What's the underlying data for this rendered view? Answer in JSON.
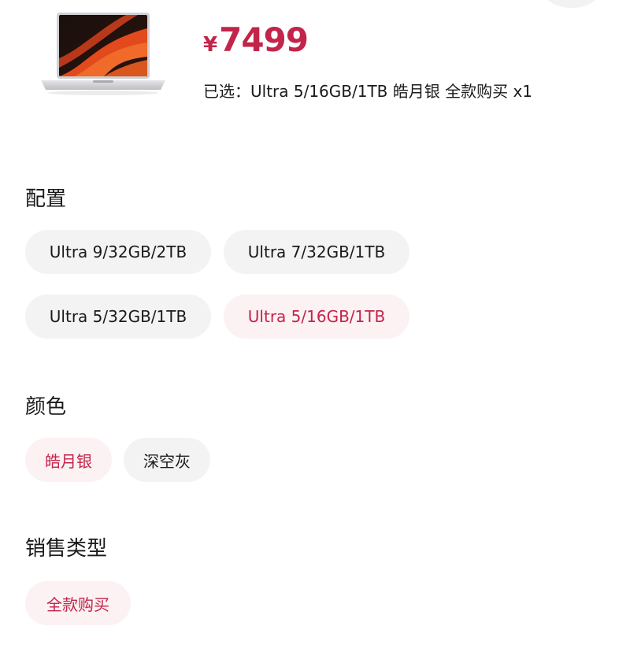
{
  "product": {
    "image": "laptop-product-image",
    "currency": "¥",
    "price": "7499",
    "selected_label": "已选：",
    "selected_value": "Ultra 5/16GB/1TB 皓月银 全款购买 x1"
  },
  "sections": {
    "config": {
      "title": "配置",
      "options": [
        {
          "label": "Ultra 9/32GB/2TB",
          "selected": false
        },
        {
          "label": "Ultra 7/32GB/1TB",
          "selected": false
        },
        {
          "label": "Ultra 5/32GB/1TB",
          "selected": false
        },
        {
          "label": "Ultra 5/16GB/1TB",
          "selected": true
        }
      ]
    },
    "color": {
      "title": "颜色",
      "options": [
        {
          "label": "皓月银",
          "selected": true
        },
        {
          "label": "深空灰",
          "selected": false
        }
      ]
    },
    "sale_type": {
      "title": "销售类型",
      "options": [
        {
          "label": "全款购买",
          "selected": true
        }
      ]
    }
  },
  "colors": {
    "accent": "#c3244a",
    "chip_bg": "#f3f3f3",
    "chip_selected_bg": "#fcf1f3"
  }
}
